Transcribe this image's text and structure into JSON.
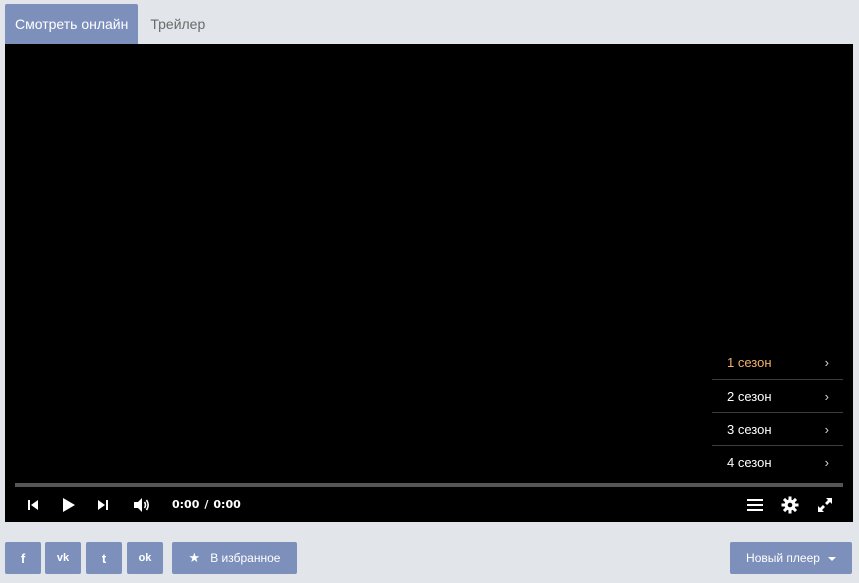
{
  "tabs": [
    {
      "label": "Смотреть онлайн",
      "active": true
    },
    {
      "label": "Трейлер",
      "active": false
    }
  ],
  "player": {
    "current_time": "0:00",
    "separator": "/",
    "duration": "0:00",
    "progress": 0,
    "seasons": [
      {
        "label": "1 сезон",
        "selected": true
      },
      {
        "label": "2 сезон",
        "selected": false
      },
      {
        "label": "3 сезон",
        "selected": false
      },
      {
        "label": "4 сезон",
        "selected": false
      }
    ],
    "chevron": "›"
  },
  "share": {
    "facebook_label": "f",
    "vk_label": "vk",
    "twitter_label": "t",
    "ok_label": "ok"
  },
  "favorites": {
    "icon": "★",
    "label": "В избранное"
  },
  "new_player": {
    "label": "Новый плеер"
  },
  "colors": {
    "accent": "#7d8fbb",
    "selected_season": "#f3b16a",
    "background": "#e2e5ea",
    "player_bg": "#000000"
  }
}
